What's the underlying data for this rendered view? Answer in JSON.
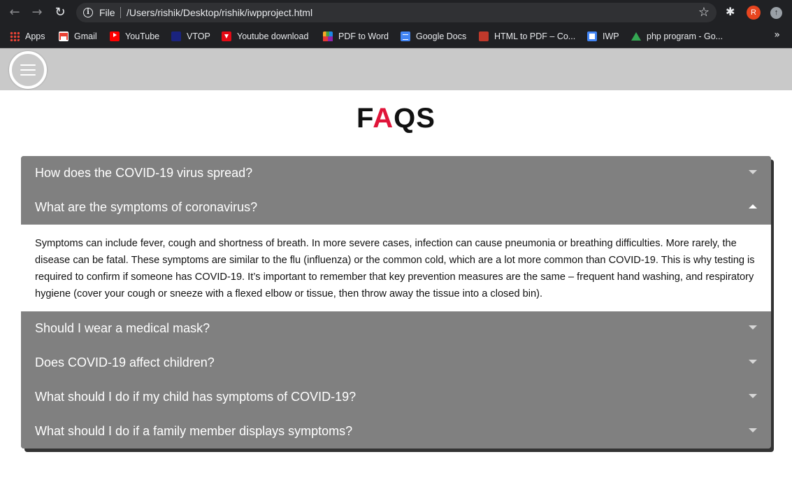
{
  "browser": {
    "scheme": "File",
    "url": "/Users/rishik/Desktop/rishik/iwpproject.html",
    "profile_initial": "R",
    "bookmarks": [
      {
        "label": "Apps",
        "icon": "apps-grid-icon"
      },
      {
        "label": "Gmail",
        "icon": "gmail-icon"
      },
      {
        "label": "YouTube",
        "icon": "youtube-icon"
      },
      {
        "label": "VTOP",
        "icon": "vtop-icon"
      },
      {
        "label": "Youtube download",
        "icon": "download-icon"
      },
      {
        "label": "PDF to Word",
        "icon": "pdf-to-word-icon"
      },
      {
        "label": "Google Docs",
        "icon": "google-docs-icon"
      },
      {
        "label": "HTML to PDF – Co...",
        "icon": "html-to-pdf-icon"
      },
      {
        "label": "IWP",
        "icon": "iwp-icon"
      },
      {
        "label": "php program - Go...",
        "icon": "google-drive-icon"
      }
    ],
    "more_label": "»"
  },
  "page": {
    "title_parts": [
      "F",
      "A",
      "QS"
    ],
    "accent_color": "#e0153a",
    "faqs": [
      {
        "question": "How does the COVID-19 virus spread?",
        "expanded": false
      },
      {
        "question": "What are the symptoms of coronavirus?",
        "expanded": true,
        "answer": "Symptoms can include fever, cough and shortness of breath. In more severe cases, infection can cause pneumonia or breathing difficulties. More rarely, the disease can be fatal. These symptoms are similar to the flu (influenza) or the common cold, which are a lot more common than COVID-19. This is why testing is required to confirm if someone has COVID-19. It’s important to remember that key prevention measures are the same – frequent hand washing, and respiratory hygiene (cover your cough or sneeze with a flexed elbow or tissue, then throw away the tissue into a closed bin)."
      },
      {
        "question": "Should I wear a medical mask?",
        "expanded": false
      },
      {
        "question": "Does COVID-19 affect children?",
        "expanded": false
      },
      {
        "question": "What should I do if my child has symptoms of COVID-19?",
        "expanded": false
      },
      {
        "question": "What should I do if a family member displays symptoms?",
        "expanded": false
      }
    ]
  }
}
